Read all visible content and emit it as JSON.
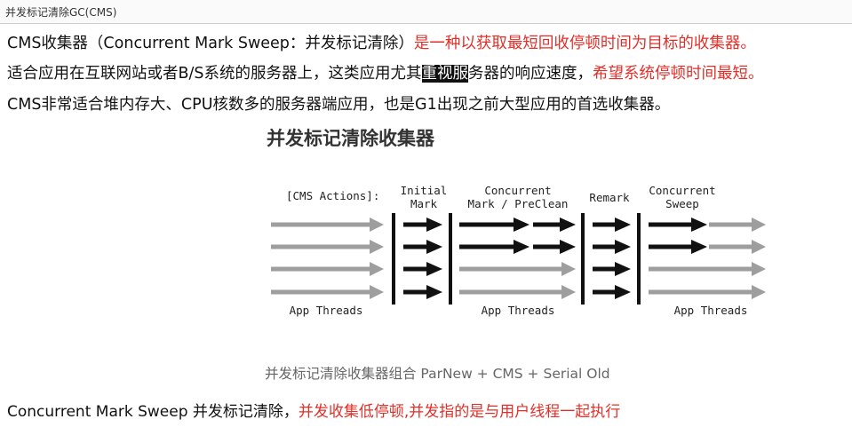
{
  "window": {
    "title": "并发标记清除GC(CMS)"
  },
  "paragraphs": {
    "p1": {
      "black": "CMS收集器（Concurrent Mark Sweep：并发标记清除）",
      "red": "是一种以获取最短回收停顿时间为目标的收集器。"
    },
    "p2": {
      "pre": "适合应用在互联网站或者B/S系统的服务器上，这类应用尤其",
      "highlight": "重视服",
      "post": "务器的响应速度，",
      "red": "希望系统停顿时间最短。"
    },
    "p3": "CMS非常适合堆内存大、CPU核数多的服务器端应用，也是G1出现之前大型应用的首选收集器。",
    "p4": {
      "black": "Concurrent Mark Sweep 并发标记清除，",
      "red": "并发收集低停顿,并发指的是与用户线程一起执行"
    }
  },
  "diagram": {
    "title": "并发标记清除收集器",
    "actions_label": "[CMS Actions]:",
    "phases": {
      "initial_mark": [
        "Initial",
        "Mark"
      ],
      "concurrent_mark": [
        "Concurrent",
        "Mark / PreClean"
      ],
      "remark": "Remark",
      "concurrent_sweep": [
        "Concurrent",
        "Sweep"
      ]
    },
    "app_threads_label": "App Threads",
    "caption": "并发标记清除收集器组合 ParNew + CMS + Serial Old",
    "colors": {
      "gc_arrow": "#111111",
      "app_arrow": "#9e9e9e",
      "red_text": "#e0302a"
    }
  }
}
